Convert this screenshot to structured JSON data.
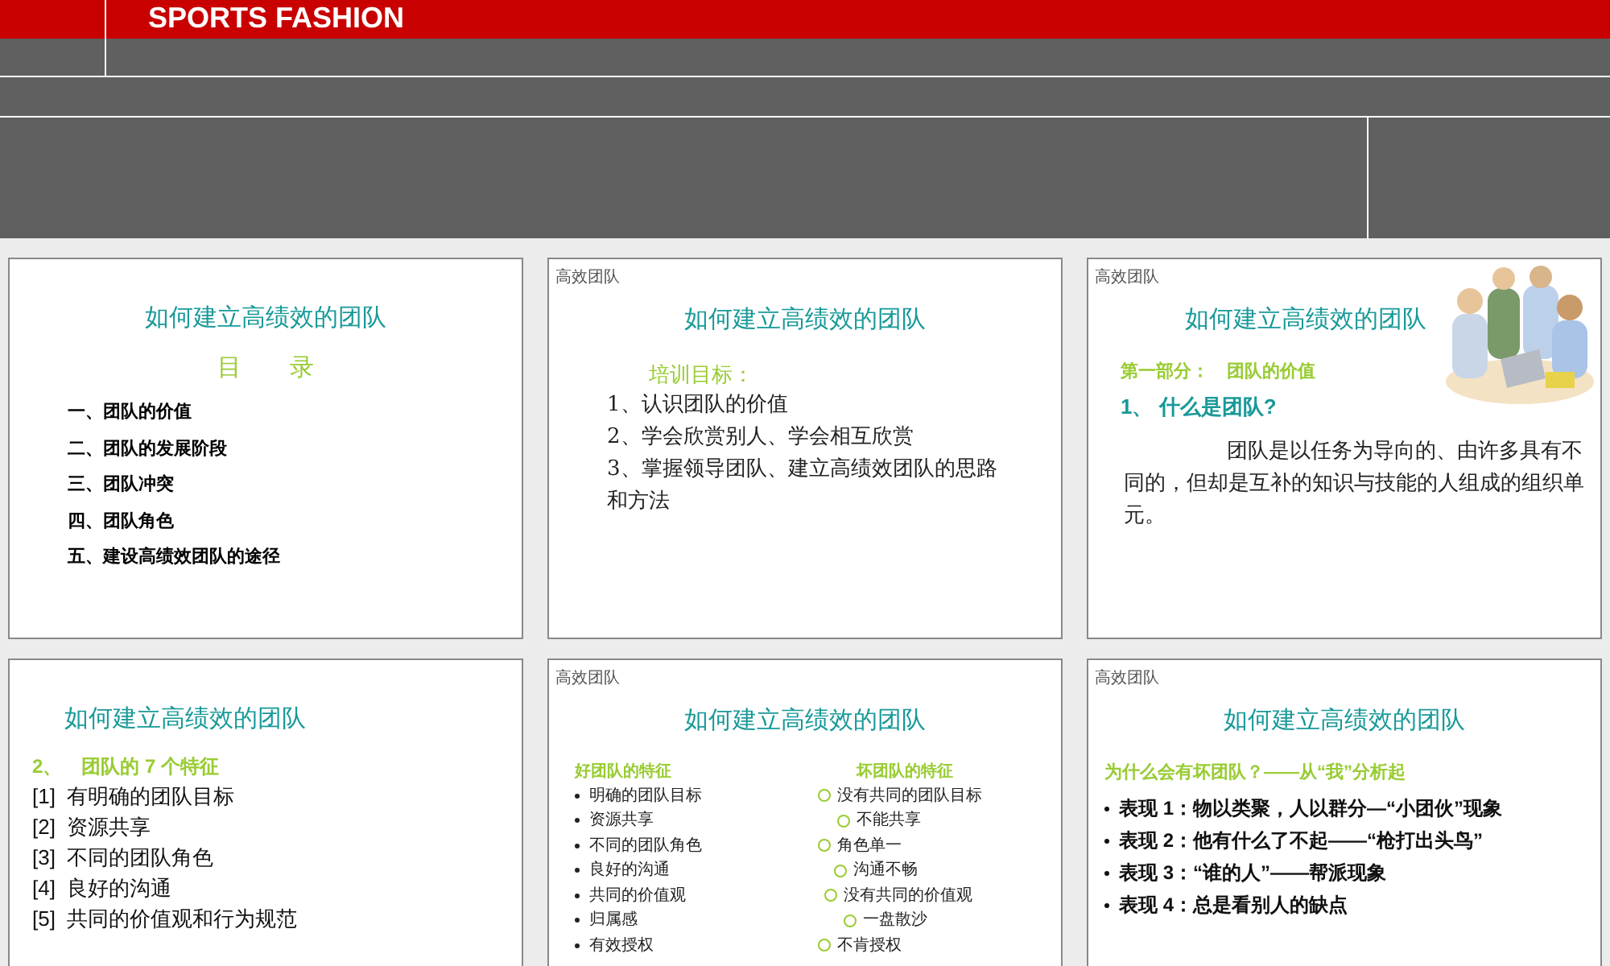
{
  "header": {
    "title": "SPORTS FASHION"
  },
  "slides": [
    {
      "kind": "toc",
      "title": "如何建立高绩效的团队",
      "heading": "目　　录",
      "items": [
        "一、团队的价值",
        "二、团队的发展阶段",
        "三、团队冲突",
        "四、团队角色",
        "五、建设高绩效团队的途径"
      ]
    },
    {
      "kind": "goals",
      "label": "高效团队",
      "title": "如何建立高绩效的团队",
      "heading": "培训目标：",
      "items": [
        "1、认识团队的价值",
        "2、学会欣赏别人、学会相互欣赏",
        "3、掌握领导团队、建立高绩效团队的思路和方法"
      ]
    },
    {
      "kind": "definition",
      "label": "高效团队",
      "title": "如何建立高绩效的团队",
      "heading": "第一部分：　团队的价值",
      "question": "1、 什么是团队?",
      "paragraph": "团队是以任务为导向的、由许多具有不同的，但却是互补的知识与技能的人组成的组织单元。"
    },
    {
      "kind": "features",
      "title": "如何建立高绩效的团队",
      "heading": "2、　团队的 7 个特征",
      "items": [
        "[1]  有明确的团队目标",
        "[2]  资源共享",
        "[3]  不同的团队角色",
        "[4]  良好的沟通",
        "[5]  共同的价值观和行为规范"
      ]
    },
    {
      "kind": "compare",
      "label": "高效团队",
      "title": "如何建立高绩效的团队",
      "left_heading": "好团队的特征",
      "right_heading": "坏团队的特征",
      "left_items": [
        "明确的团队目标",
        "资源共享",
        "不同的团队角色",
        "良好的沟通",
        "共同的价值观",
        "归属感",
        "有效授权"
      ],
      "right_items": [
        "没有共同的团队目标",
        "不能共享",
        "角色单一",
        "沟通不畅",
        "没有共同的价值观",
        "一盘散沙",
        "不肯授权"
      ]
    },
    {
      "kind": "bullets",
      "label": "高效团队",
      "title": "如何建立高绩效的团队",
      "heading": "为什么会有坏团队？——从“我”分析起",
      "items": [
        "表现 1：物以类聚，人以群分—“小团伙”现象",
        "表现 2：他有什么了不起——“枪打出头鸟”",
        "表现 3：“谁的人”——帮派现象",
        "表现 4：总是看别人的缺点"
      ]
    }
  ]
}
